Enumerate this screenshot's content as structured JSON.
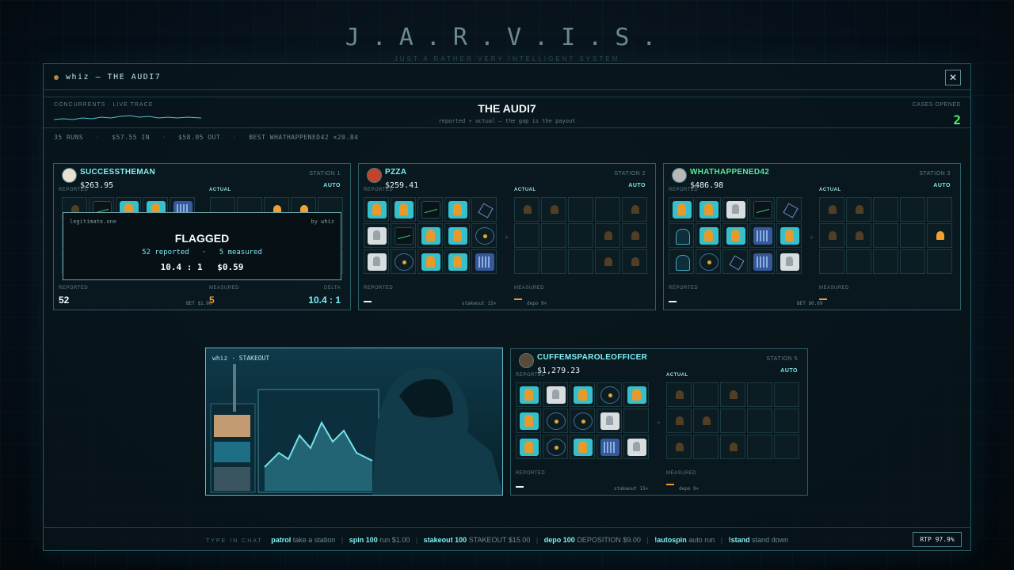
{
  "brand": {
    "title": "J.A.R.V.I.S.",
    "subtitle": "JUST A RATHER VERY INTELLIGENT SYSTEM"
  },
  "window": {
    "title": "whiz — THE AUDI7",
    "close_label": "✕"
  },
  "header": {
    "concurrents_label": "CONCURRENTS · LIVE TRACE",
    "audit_title": "THE AUDI7",
    "audit_subtitle": "reported ÷ actual — the gap is the payout",
    "cases_label": "CASES OPENED",
    "cases_value": "2"
  },
  "stats": {
    "runs": "35 RUNS",
    "in": "$57.55 IN",
    "out": "$58.05 OUT",
    "best": "BEST WHATHAPPENED42 ×20.84",
    "sep": "·"
  },
  "labels": {
    "reported": "REPORTED",
    "actual": "ACTUAL",
    "measured": "MEASURED",
    "delta": "DELTA",
    "auto": "AUTO",
    "plus": "÷",
    "dash": "—"
  },
  "stations": [
    {
      "name": "SUCCESSTHEMAN",
      "amount": "$263.95",
      "station": "STATION 1",
      "reported_value": "52",
      "measured_value": "5",
      "delta_value": "10.4 : 1",
      "bet": "BET $1.00",
      "reported_tiles": [
        "ghost",
        "chart",
        "orange",
        "orange",
        "server",
        "empty",
        "empty",
        "empty",
        "empty",
        "empty",
        "empty",
        "empty",
        "empty",
        "empty",
        "empty"
      ],
      "actual_tiles": [
        "empty",
        "empty",
        "dim",
        "dim",
        "empty",
        "empty",
        "empty",
        "empty",
        "empty",
        "empty",
        "empty",
        "empty",
        "empty",
        "empty",
        "empty"
      ]
    },
    {
      "name": "PZZA",
      "amount": "$259.41",
      "station": "STATION 2",
      "stakeout": "stakeout 15×",
      "depo": "depo 9×",
      "reported_tiles": [
        "orange",
        "orange",
        "chart",
        "orange",
        "cube",
        "white",
        "chart",
        "orange",
        "orange",
        "atom",
        "white",
        "atom",
        "orange",
        "orange",
        "server"
      ],
      "actual_tiles": [
        "ghost",
        "ghost",
        "empty",
        "empty",
        "ghost",
        "empty",
        "empty",
        "empty",
        "ghost",
        "ghost",
        "empty",
        "empty",
        "empty",
        "ghost",
        "ghost"
      ]
    },
    {
      "name": "WHATHAPPENED42",
      "amount": "$486.98",
      "station": "STATION 3",
      "bet": "BET $0.69",
      "reported_tiles": [
        "orange",
        "orange",
        "white",
        "chart",
        "cube",
        "hood",
        "orange",
        "orange",
        "server",
        "orange",
        "hood",
        "atom",
        "cube",
        "server",
        "white"
      ],
      "actual_tiles": [
        "ghost",
        "ghost",
        "empty",
        "empty",
        "empty",
        "ghost",
        "ghost",
        "empty",
        "empty",
        "dim",
        "empty",
        "empty",
        "empty",
        "empty",
        "empty"
      ]
    },
    {
      "name": "CUFFEMSPAROLEOFFICER",
      "amount": "$1,279.23",
      "station": "STATION 5",
      "stakeout": "stakeout 15×",
      "depo": "depo 9×",
      "reported_tiles": [
        "orange",
        "white",
        "orange",
        "atom",
        "orange",
        "orange",
        "atom",
        "atom",
        "white",
        "empty",
        "orange",
        "atom",
        "orange",
        "server",
        "white"
      ],
      "actual_tiles": [
        "ghost",
        "empty",
        "ghost",
        "empty",
        "empty",
        "ghost",
        "ghost",
        "empty",
        "empty",
        "empty",
        "ghost",
        "empty",
        "ghost",
        "empty",
        "empty"
      ]
    }
  ],
  "flag": {
    "source": "legitimate.one",
    "by": "by whiz",
    "title": "FLAGGED",
    "reported": "52 reported",
    "sep": "·",
    "measured": "5 measured",
    "ratio": "10.4 : 1",
    "amount": "$0.59"
  },
  "video": {
    "label": "whiz · STAKEOUT"
  },
  "chat": {
    "type_label": "TYPE IN CHAT",
    "commands": [
      {
        "cmd": "patrol",
        "desc": "take a station"
      },
      {
        "cmd": "spin 100",
        "desc": "run $1.00"
      },
      {
        "cmd": "stakeout 100",
        "desc": "STAKEOUT $15.00"
      },
      {
        "cmd": "depo 100",
        "desc": "DEPOSITION $9.00"
      },
      {
        "cmd": "!autospin",
        "desc": "auto run"
      },
      {
        "cmd": "!stand",
        "desc": "stand down"
      }
    ],
    "rtp": "RTP 97.9%"
  },
  "colors": {
    "accent": "#7ff0f5",
    "green": "#4cf26b",
    "orange": "#e89a2e",
    "border": "#2b5f66"
  }
}
